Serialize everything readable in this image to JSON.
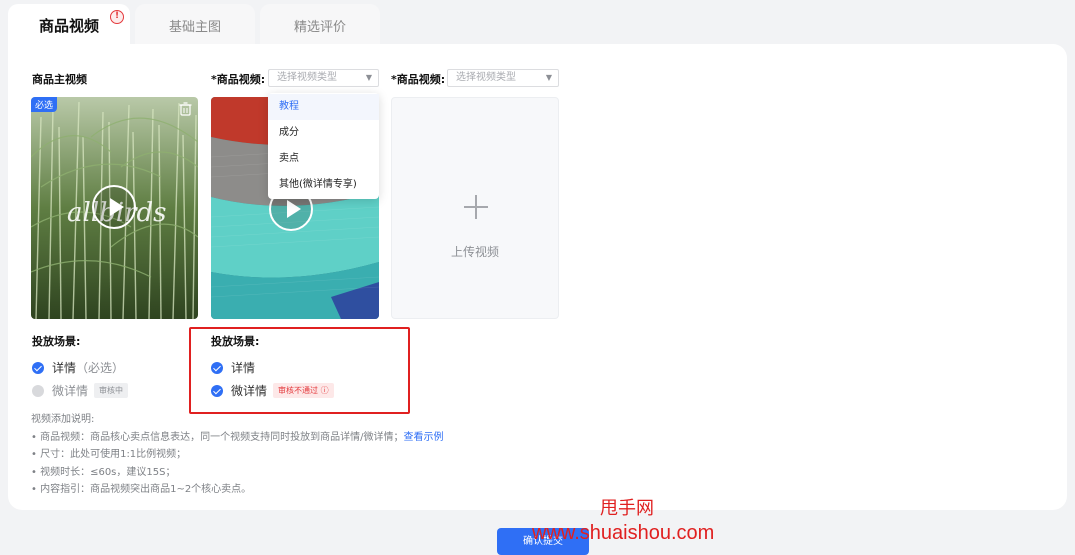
{
  "tabs": [
    {
      "label": "商品视频",
      "alert": "!"
    },
    {
      "label": "基础主图"
    },
    {
      "label": "精选评价"
    }
  ],
  "main_video": {
    "label": "商品主视频",
    "required_badge": "必选",
    "scene_label": "投放场景:",
    "scene_detail": "详情",
    "scene_detail_note": "（必选）",
    "scene_micro": "微详情",
    "scene_micro_status": "审核中"
  },
  "video2": {
    "label": "*商品视频:",
    "select_placeholder": "选择视频类型",
    "scene_label": "投放场景:",
    "scene_detail": "详情",
    "scene_micro": "微详情",
    "scene_micro_status": "审核不通过"
  },
  "video3": {
    "label": "*商品视频:",
    "select_placeholder": "选择视频类型"
  },
  "dropdown_options": [
    "教程",
    "成分",
    "卖点",
    "其他(微详情专享)"
  ],
  "upload": {
    "label": "上传视频"
  },
  "notes": {
    "title": "视频添加说明:",
    "line1": "• 商品视频：商品核心卖点信息表达，同一个视频支持同时投放到商品详情/微详情；",
    "line1_link": "查看示例",
    "line2": "• 尺寸：此处可使用1:1比例视频；",
    "line3": "• 视频时长：≤60s，建议15S；",
    "line4": "• 内容指引：商品视频突出商品1~2个核心卖点。"
  },
  "submit_label": "确认提交",
  "watermark": {
    "cn": "甩手网",
    "url": "www.shuaishou.com"
  },
  "colors": {
    "accent": "#2f6ff5",
    "error": "#e02020"
  }
}
